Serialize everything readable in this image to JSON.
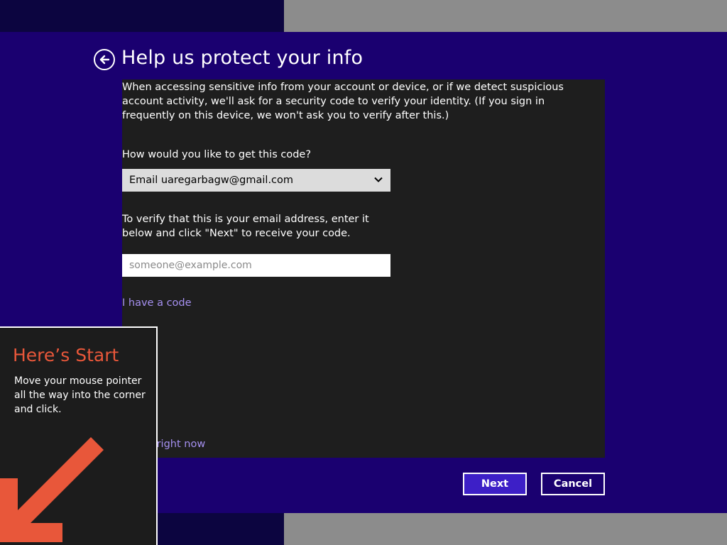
{
  "header": {
    "title": "Help us protect your info"
  },
  "content": {
    "intro": "When accessing sensitive info from your account or device, or if we detect suspicious account activity, we'll ask for a security code to verify your identity. (If you sign in frequently on this device, we won't ask you to verify after this.)",
    "question": "How would you like to get this code?",
    "method_select": {
      "selected": "Email uaregarbagw@gmail.com"
    },
    "verify_instructions": "To verify that this is your email address, enter it below and click \"Next\" to receive your code.",
    "email_input": {
      "value": "",
      "placeholder": "someone@example.com"
    },
    "have_code_link": "I have a code",
    "skip_link": "lo this right now"
  },
  "footer": {
    "next_label": "Next",
    "cancel_label": "Cancel"
  },
  "start_tip": {
    "title": "Here’s Start",
    "body": "Move your mouse pointer all the way into the corner and click."
  },
  "colors": {
    "background": "#1a0070",
    "panel": "#1e1e1e",
    "link": "#a590f0",
    "next_button": "#3d1fc7",
    "tip_accent": "#e8573a"
  }
}
